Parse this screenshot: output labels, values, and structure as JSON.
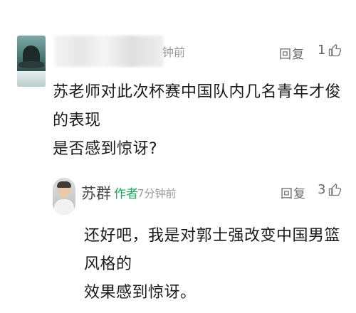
{
  "comments": [
    {
      "time_suffix": "钟前",
      "reply_label": "回复",
      "likes": "1",
      "text_line1": "苏老师对此次杯赛中国队内几名青年才俊的表现",
      "text_line2": "是否感到惊讶?"
    },
    {
      "username": "苏群",
      "badge": "作者",
      "timestamp": "7分钟前",
      "reply_label": "回复",
      "likes": "3",
      "text_line1": "还好吧，我是对郭士强改变中国男篮风格的",
      "text_line2": "效果感到惊讶。"
    }
  ],
  "icons": {
    "like": "thumbs-up-icon"
  },
  "colors": {
    "author_badge": "#1faa5a",
    "meta_text": "#9a9a9a"
  }
}
